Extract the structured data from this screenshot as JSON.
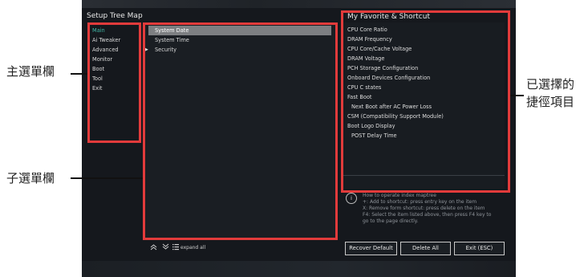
{
  "callouts": {
    "main_menu": "主選單欄",
    "sub_menu": "子選單欄",
    "shortcut_line1": "已選擇的",
    "shortcut_line2": "捷徑項目"
  },
  "setup_tree": {
    "title": "Setup Tree Map",
    "main_menu": [
      "Main",
      "Ai Tweaker",
      "Advanced",
      "Monitor",
      "Boot",
      "Tool",
      "Exit"
    ],
    "active_main": "Main",
    "sub_menu": [
      "System Date",
      "System Time",
      "Security"
    ],
    "selected_sub": "System Date"
  },
  "toolbar": {
    "collapse_icon": "double-chevron-up-icon",
    "expand_icon": "double-chevron-down-icon",
    "list_icon": "list-icon",
    "expand_all_label": "expand all"
  },
  "favorites": {
    "title": "My Favorite & Shortcut",
    "items": [
      "CPU Core Ratio",
      "DRAM Frequency",
      "CPU Core/Cache Voltage",
      "DRAM Voltage",
      "PCH Storage Configuration",
      "Onboard Devices Configuration",
      "CPU C states",
      "Fast Boot",
      "Next Boot after AC Power Loss",
      "CSM (Compatibility Support Module)",
      "Boot Logo Display",
      "POST Delay Time"
    ]
  },
  "help": {
    "icon": "info-icon",
    "lines": [
      "How to operate index maptree",
      "+: Add to shortcut: press entry key on the item",
      "X: Remove form shortcut: press delete on the item",
      "F4: Select the item listed above, then press F4 key to",
      "go to the page directly."
    ]
  },
  "buttons": {
    "recover_default": "Recover Default",
    "delete_all": "Delete All",
    "exit": "Exit (ESC)"
  },
  "colors": {
    "highlight": "#e23b3b",
    "active_menu": "#3fb8a6",
    "selected_row": "#7d7f82"
  }
}
